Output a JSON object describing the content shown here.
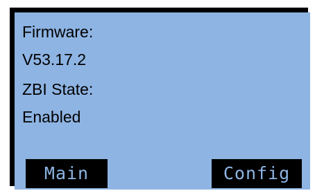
{
  "display": {
    "firmware_label": "Firmware:",
    "firmware_value": "V53.17.2",
    "zbi_label": "ZBI State:",
    "zbi_value": "Enabled"
  },
  "softkeys": {
    "left_label": "Main",
    "right_label": "Config"
  },
  "colors": {
    "screen_background": "#8eb4e3",
    "bezel": "#000000",
    "text": "#000000",
    "softkey_text": "#8eb4e3"
  }
}
